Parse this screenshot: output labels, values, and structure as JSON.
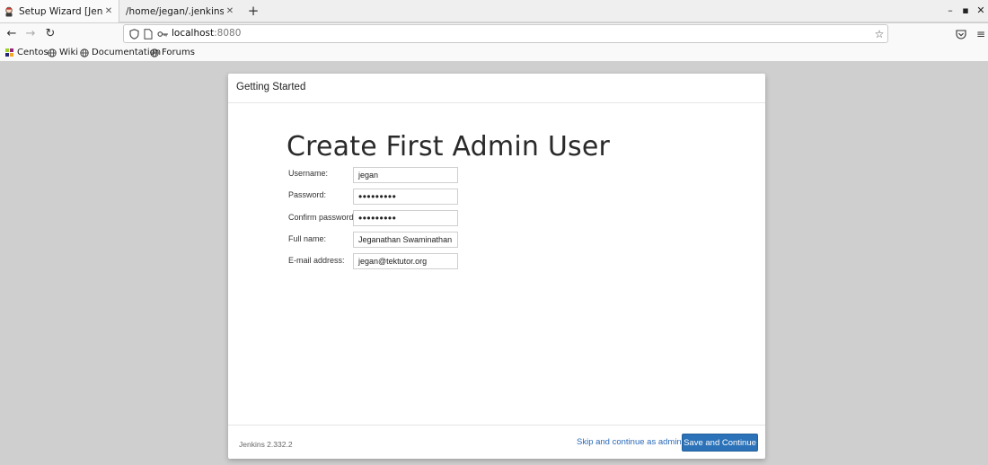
{
  "browser": {
    "tabs": [
      {
        "title": "Setup Wizard [Jenkins]",
        "active": true
      },
      {
        "title": "/home/jegan/.jenkins/secrets/",
        "active": false
      }
    ],
    "new_tab_label": "+",
    "url_host": "localhost",
    "url_port": ":8080",
    "bookmarks": [
      {
        "label": "Centos",
        "icon": "centos-icon"
      },
      {
        "label": "Wiki",
        "icon": "globe-icon"
      },
      {
        "label": "Documentation",
        "icon": "globe-icon"
      },
      {
        "label": "Forums",
        "icon": "globe-icon"
      }
    ]
  },
  "dialog": {
    "header_title": "Getting Started",
    "heading": "Create First Admin User",
    "fields": [
      {
        "label": "Username:",
        "value": "jegan"
      },
      {
        "label": "Password:",
        "value": "•••••••••"
      },
      {
        "label": "Confirm password:",
        "value": "•••••••••"
      },
      {
        "label": "Full name:",
        "value": "Jeganathan Swaminathan"
      },
      {
        "label": "E-mail address:",
        "value": "jegan@tektutor.org"
      }
    ],
    "version": "Jenkins 2.332.2",
    "skip_label": "Skip and continue as admin",
    "save_label": "Save and Continue"
  },
  "colors": {
    "accent_button": "#2b72b8",
    "link": "#2a6ab8",
    "backdrop": "#cfcfcf"
  }
}
